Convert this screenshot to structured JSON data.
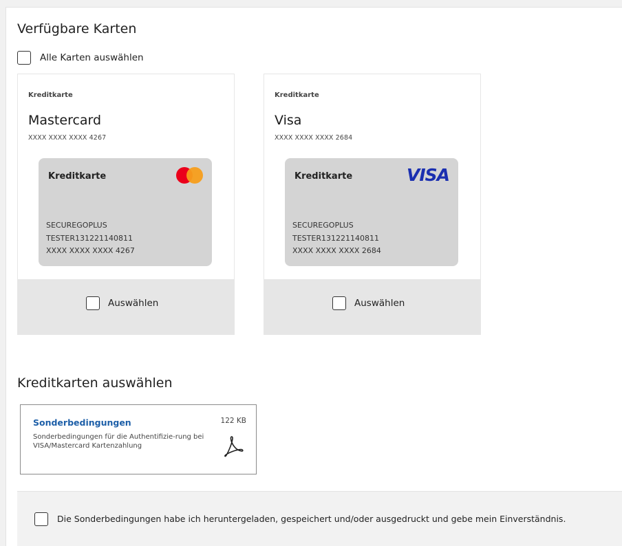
{
  "available_cards": {
    "title": "Verfügbare Karten",
    "select_all_label": "Alle Karten auswählen",
    "cards": [
      {
        "type": "Kreditkarte",
        "name": "Mastercard",
        "number": "XXXX XXXX XXXX 4267",
        "card_type": "Kreditkarte",
        "holder_line1": "SECUREGOPLUS",
        "holder_line2": "TESTER131221140811",
        "card_number": "XXXX XXXX XXXX 4267",
        "logo": "mastercard-logo",
        "select_label": "Auswählen"
      },
      {
        "type": "Kreditkarte",
        "name": "Visa",
        "number": "XXXX XXXX XXXX 2684",
        "card_type": "Kreditkarte",
        "holder_line1": "SECUREGOPLUS",
        "holder_line2": "TESTER131221140811",
        "card_number": "XXXX XXXX XXXX 2684",
        "logo": "visa-logo",
        "logo_text": "VISA",
        "select_label": "Auswählen"
      }
    ]
  },
  "select_section": {
    "title": "Kreditkarten auswählen"
  },
  "document": {
    "title": "Sonderbedingungen",
    "description": "Sonderbedingungen für die Authentifizie-rung bei VISA/Mastercard Kartenzahlung",
    "size": "122 KB",
    "icon": "pdf-icon"
  },
  "consent": {
    "label": "Die Sonderbedingungen habe ich heruntergeladen, gespeichert und/oder ausgedruckt und gebe mein Einverständnis."
  },
  "colors": {
    "link": "#1d5fa8",
    "visa_blue": "#1a2fb0",
    "mc_red": "#eb001b",
    "mc_orange": "#f79e1b",
    "card_bg": "#d4d4d4",
    "footer_bg": "#e6e6e6"
  }
}
